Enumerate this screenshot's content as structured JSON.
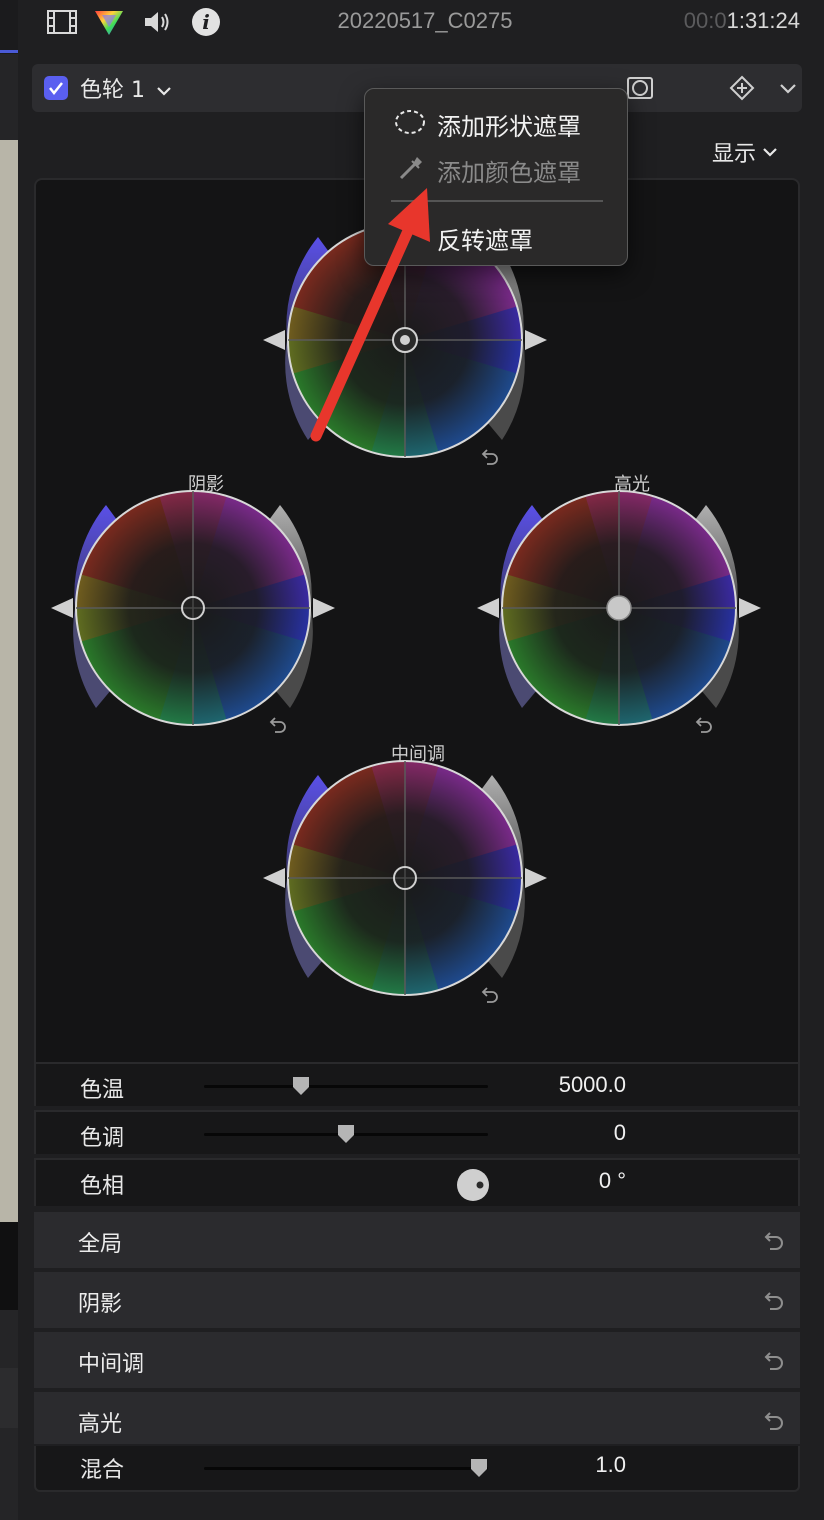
{
  "toolbar": {
    "icons": [
      "film-icon",
      "color-inspector-icon",
      "audio-icon",
      "info-icon"
    ],
    "clip_name": "20220517_C0275",
    "timecode_dim": "00:0",
    "timecode_bright": "1:31:24"
  },
  "effect": {
    "enabled": true,
    "name": "色轮 1",
    "accent": "#5a5ff0"
  },
  "show_menu": {
    "label": "显示"
  },
  "context_menu": {
    "items": [
      {
        "label": "添加形状遮罩",
        "icon": "shape-mask-icon",
        "enabled": true
      },
      {
        "label": "添加颜色遮罩",
        "icon": "eyedropper-icon",
        "enabled": false
      },
      {
        "label": "反转遮罩",
        "icon": "",
        "enabled": true
      }
    ]
  },
  "wheels": {
    "global": {
      "label": ""
    },
    "shadows": {
      "label": "阴影"
    },
    "highlights": {
      "label": "高光"
    },
    "midtones": {
      "label": "中间调"
    }
  },
  "params": {
    "temperature": {
      "label": "色温",
      "value": "5000.0",
      "level": 0.34
    },
    "tint": {
      "label": "色调",
      "value": "0",
      "level": 0.5
    },
    "hue": {
      "label": "色相",
      "value": "0 °"
    }
  },
  "sections": [
    {
      "label": "全局"
    },
    {
      "label": "阴影"
    },
    {
      "label": "中间调"
    },
    {
      "label": "高光"
    }
  ],
  "blend": {
    "label": "混合",
    "value": "1.0",
    "level": 0.97
  },
  "colors": {
    "arrow": "#e8362c",
    "saturation_handle": "#4d47d6",
    "brightness_handle": "#8a8a8a"
  }
}
